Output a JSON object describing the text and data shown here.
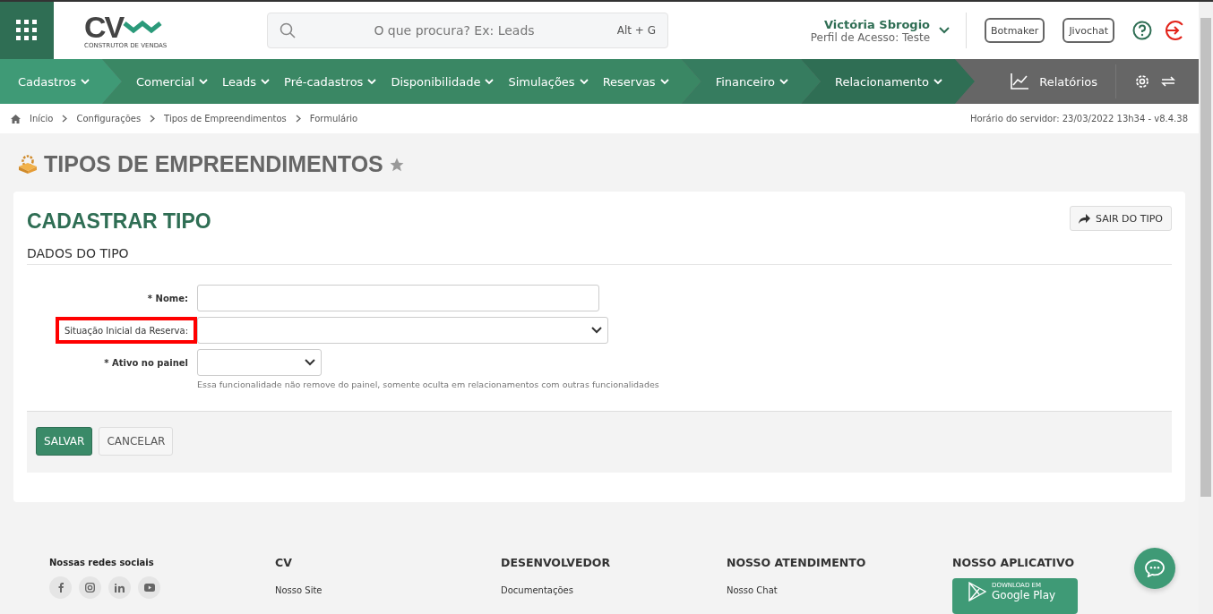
{
  "header": {
    "search": {
      "placeholder": "O que procura? Ex: Leads",
      "shortcut": "Alt + G"
    },
    "logo": {
      "mark": "CV",
      "tagline": "CONSTRUTOR DE VENDAS"
    },
    "user": {
      "name": "Victória Sbrogio",
      "profile": "Perfil de Acesso: Teste"
    },
    "buttons": [
      "Botmaker",
      "Jivochat"
    ]
  },
  "nav": {
    "segments": [
      {
        "color": "#3f9a76",
        "items": [
          "Cadastros"
        ]
      },
      {
        "color": "#3a8764",
        "items": [
          "Comercial",
          "Leads",
          "Pré-cadastros",
          "Disponibilidade",
          "Simulações",
          "Reservas"
        ]
      },
      {
        "color": "#367c5f",
        "items": [
          "Financeiro"
        ]
      },
      {
        "color": "#2f6e54",
        "items": [
          "Relacionamento"
        ]
      }
    ],
    "reports": "Relatórios"
  },
  "breadcrumb": [
    "Início",
    "Configurações",
    "Tipos de Empreendimentos",
    "Formulário"
  ],
  "server_time": "Horário do servidor: 23/03/2022 13h34 - v8.4.38",
  "page_title": "TIPOS DE EMPREENDIMENTOS",
  "card": {
    "title": "CADASTRAR TIPO",
    "exit_button": "SAIR DO TIPO",
    "section": "DADOS DO TIPO",
    "fields": [
      {
        "label": "* Nome:",
        "kind": "text",
        "required": true,
        "highlighted": false
      },
      {
        "label": "Situação Inicial da Reserva:",
        "kind": "select",
        "required": false,
        "highlighted": true
      },
      {
        "label": "* Ativo no painel",
        "kind": "select-small",
        "required": true,
        "highlighted": false,
        "help": "Essa funcionalidade não remove do painel, somente oculta em relacionamentos com outras funcionalidades"
      }
    ],
    "save": "SALVAR",
    "cancel": "CANCELAR"
  },
  "footer": {
    "social_title": "Nossas redes sociais",
    "columns": [
      {
        "title": "CV",
        "links": [
          "Nosso Site"
        ]
      },
      {
        "title": "DESENVOLVEDOR",
        "links": [
          "Documentações"
        ]
      },
      {
        "title": "NOSSO ATENDIMENTO",
        "links": [
          "Nosso Chat"
        ]
      },
      {
        "title": "NOSSO APLICATIVO",
        "store_small": "DOWNLOAD EM",
        "store": "Google Play"
      }
    ]
  }
}
